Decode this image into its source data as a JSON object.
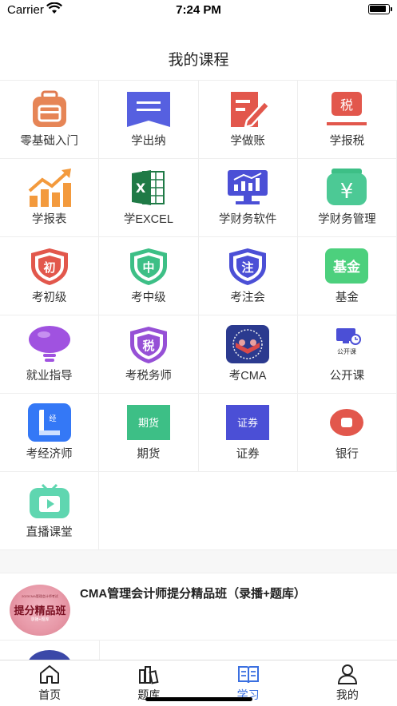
{
  "status": {
    "carrier": "Carrier",
    "time": "7:24 PM"
  },
  "page": {
    "title": "我的课程"
  },
  "categories": [
    {
      "label": "零基础入门",
      "icon": "backpack-icon"
    },
    {
      "label": "学出纳",
      "icon": "bookmark-icon"
    },
    {
      "label": "学做账",
      "icon": "ledger-pen-icon"
    },
    {
      "label": "学报税",
      "icon": "tax-stamp-icon"
    },
    {
      "label": "学报表",
      "icon": "bar-chart-icon"
    },
    {
      "label": "学EXCEL",
      "icon": "excel-icon"
    },
    {
      "label": "学财务软件",
      "icon": "monitor-chart-icon"
    },
    {
      "label": "学财务管理",
      "icon": "yuan-bag-icon"
    },
    {
      "label": "考初级",
      "icon": "shield-chu-icon",
      "badge": "初"
    },
    {
      "label": "考中级",
      "icon": "shield-zhong-icon",
      "badge": "中"
    },
    {
      "label": "考注会",
      "icon": "shield-zhu-icon",
      "badge": "注"
    },
    {
      "label": "基金",
      "icon": "fund-icon",
      "badge": "基金"
    },
    {
      "label": "就业指导",
      "icon": "lightbulb-icon"
    },
    {
      "label": "考税务师",
      "icon": "shield-shui-icon",
      "badge": "税"
    },
    {
      "label": "考CMA",
      "icon": "cma-icon"
    },
    {
      "label": "公开课",
      "icon": "open-class-icon",
      "badge": "公开课"
    },
    {
      "label": "考经济师",
      "icon": "book-jing-icon",
      "badge": "经"
    },
    {
      "label": "期货",
      "icon": "futures-icon",
      "badge": "期货"
    },
    {
      "label": "证券",
      "icon": "securities-icon",
      "badge": "证券"
    },
    {
      "label": "银行",
      "icon": "bank-icon"
    },
    {
      "label": "直播课堂",
      "icon": "tv-live-icon"
    }
  ],
  "tax_badge": "税",
  "course": {
    "title": "CMA管理会计师提分精品班（录播+题库）",
    "thumb_top": "2023CMA管理会计师考试",
    "thumb_main": "提分精品班",
    "thumb_sub": "录播+题库"
  },
  "tabs": [
    {
      "label": "首页",
      "icon": "home-icon"
    },
    {
      "label": "题库",
      "icon": "books-icon"
    },
    {
      "label": "学习",
      "icon": "study-icon"
    },
    {
      "label": "我的",
      "icon": "user-icon"
    }
  ],
  "colors": {
    "accent": "#3a6fe0",
    "red": "#e2574c",
    "green": "#4cc38a",
    "indigo": "#4b4fd6"
  }
}
